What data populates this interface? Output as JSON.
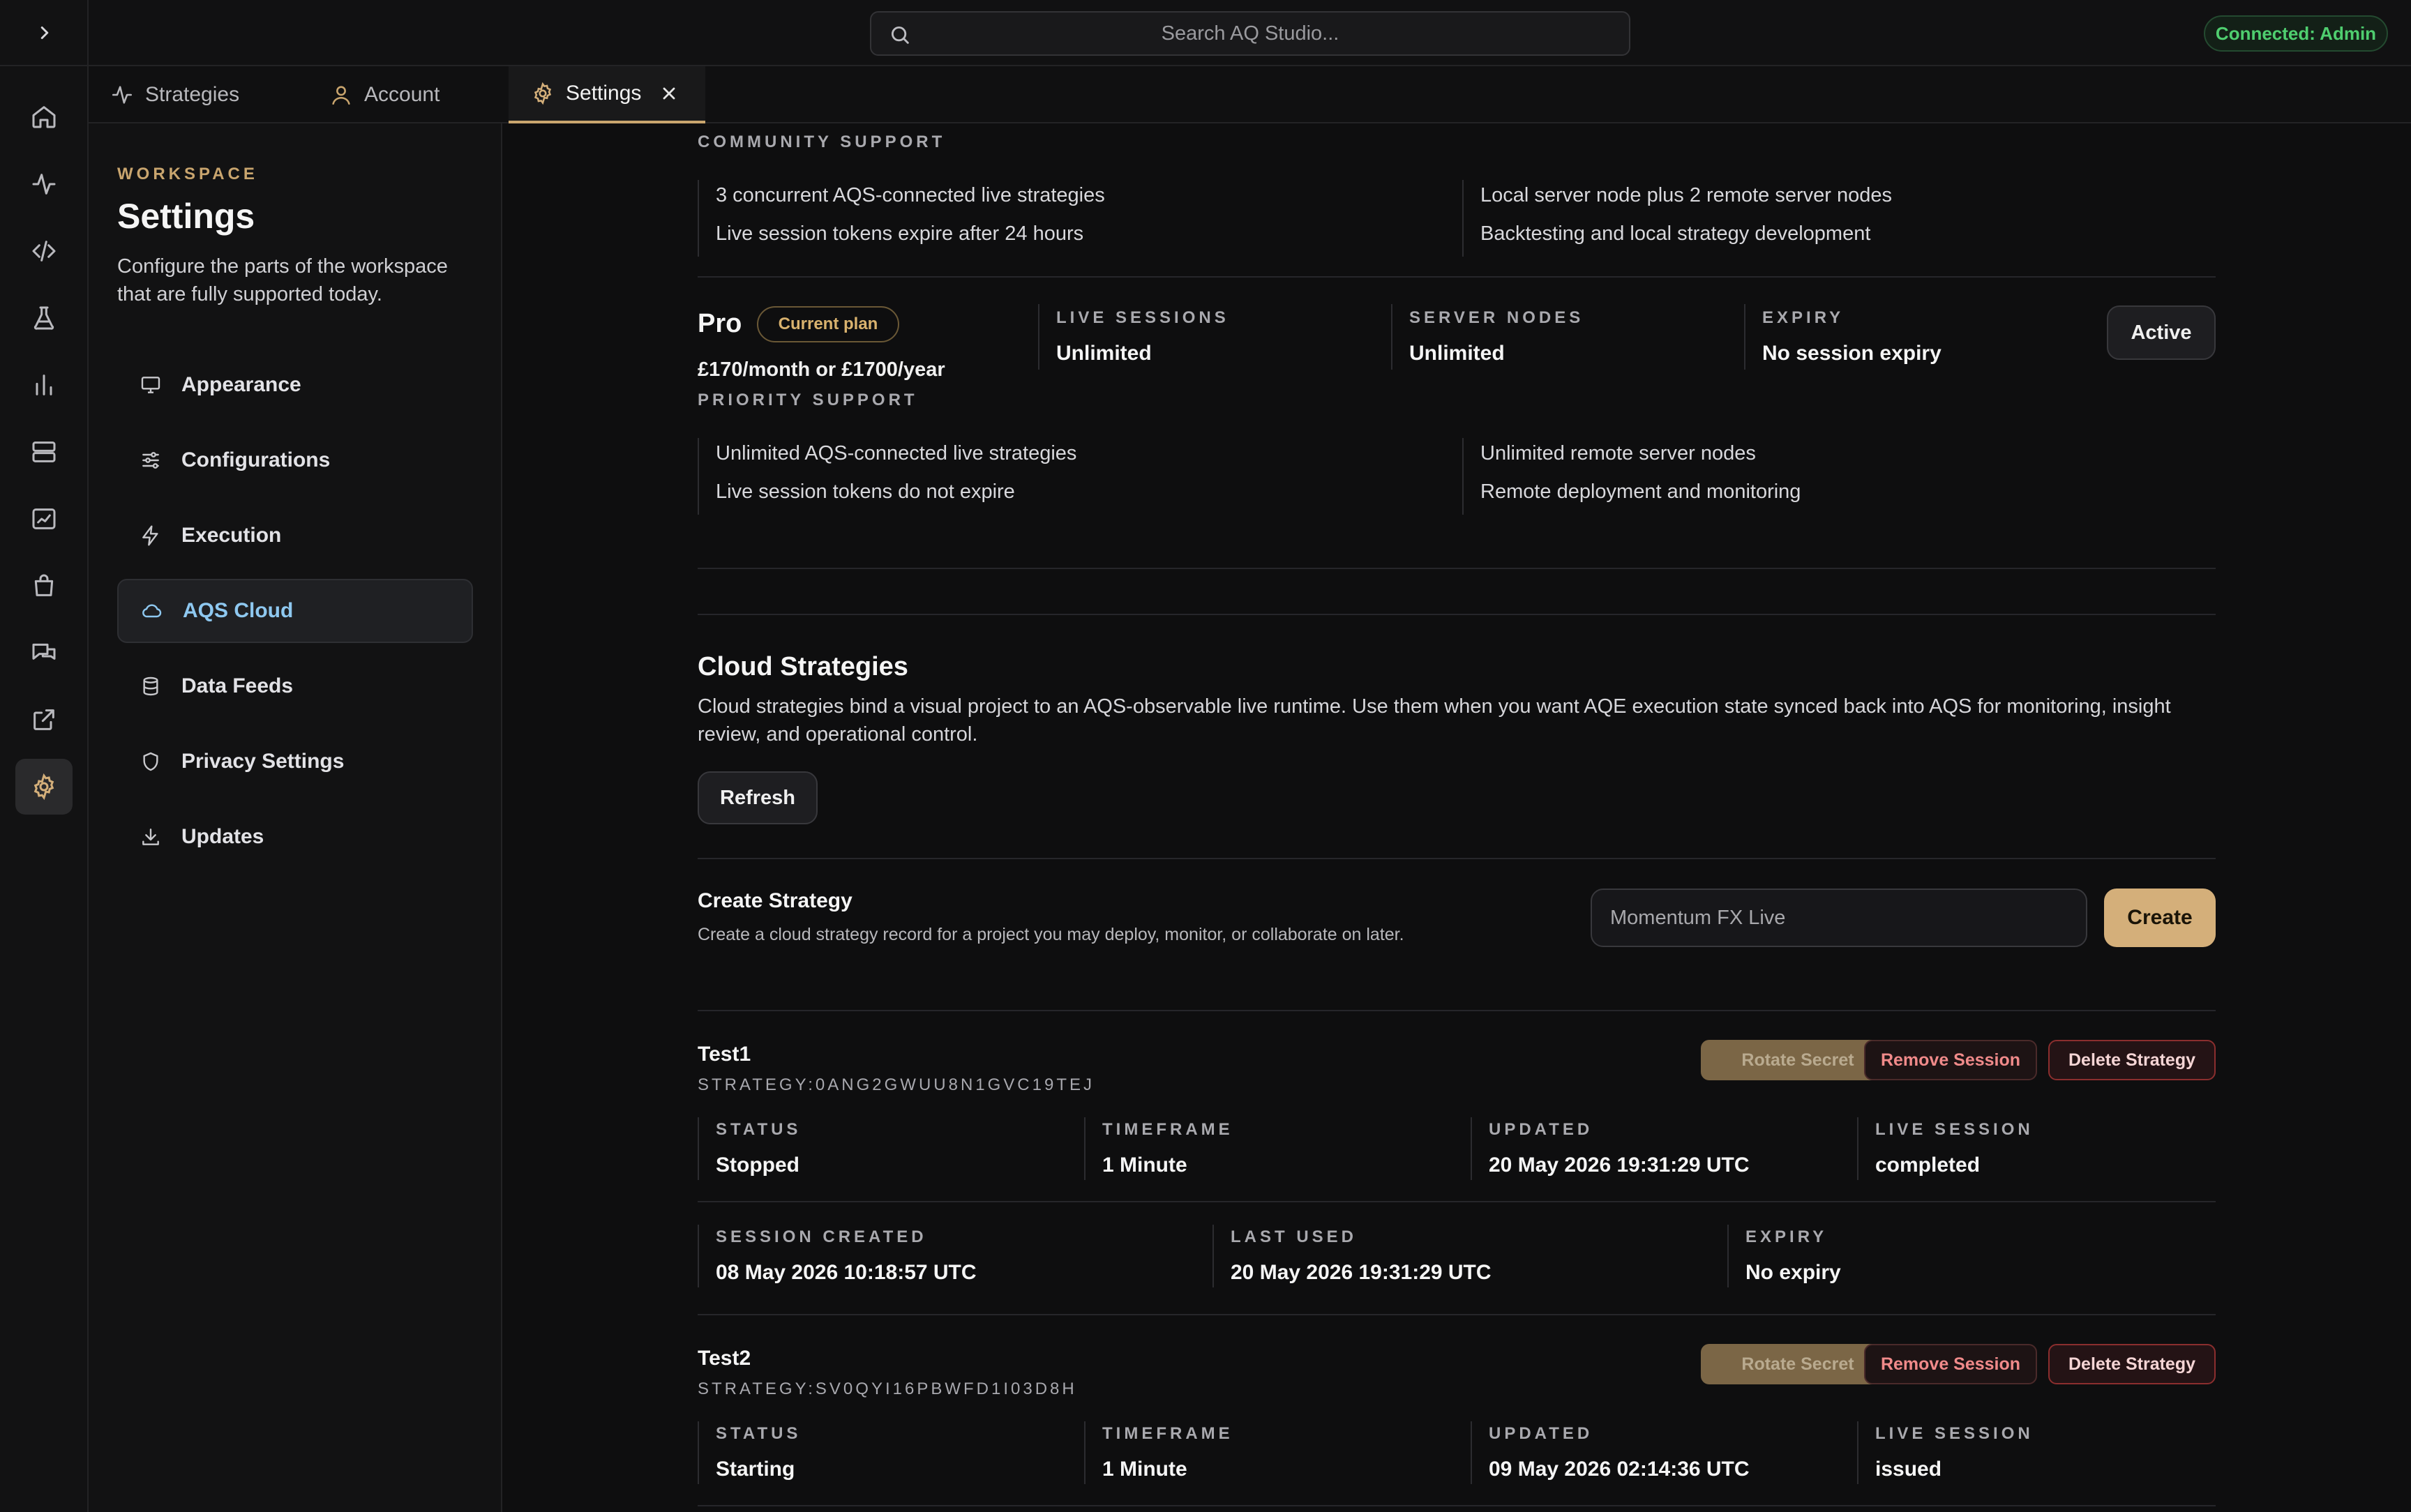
{
  "topbar": {
    "search_placeholder": "Search AQ Studio...",
    "connection": "Connected: Admin"
  },
  "tabs": [
    {
      "label": "Strategies"
    },
    {
      "label": "Account"
    },
    {
      "label": "Settings",
      "active": true
    }
  ],
  "rail": {
    "icons": [
      "home-icon",
      "activity-icon",
      "code-icon",
      "flask-icon",
      "bar-chart-icon",
      "server-icon",
      "line-chart-icon",
      "shopping-bag-icon",
      "messages-icon",
      "external-link-icon",
      "settings-icon"
    ],
    "active": "settings-icon"
  },
  "sidebar": {
    "eyebrow": "WORKSPACE",
    "title": "Settings",
    "description": "Configure the parts of the workspace that are fully supported today.",
    "items": [
      {
        "label": "Appearance",
        "icon": "monitor-icon"
      },
      {
        "label": "Configurations",
        "icon": "sliders-icon"
      },
      {
        "label": "Execution",
        "icon": "zap-icon"
      },
      {
        "label": "AQS Cloud",
        "icon": "cloud-icon",
        "active": true
      },
      {
        "label": "Data Feeds",
        "icon": "database-icon"
      },
      {
        "label": "Privacy Settings",
        "icon": "shield-icon"
      },
      {
        "label": "Updates",
        "icon": "download-icon"
      }
    ]
  },
  "community": {
    "label": "COMMUNITY SUPPORT",
    "features": [
      "3 concurrent AQS-connected live strategies",
      "Live session tokens expire after 24 hours",
      "Local server node plus 2 remote server nodes",
      "Backtesting and local strategy development"
    ]
  },
  "pro": {
    "name": "Pro",
    "badge": "Current plan",
    "price": "£170/month or £1700/year",
    "support": "PRIORITY SUPPORT",
    "stats": [
      {
        "label": "LIVE SESSIONS",
        "value": "Unlimited"
      },
      {
        "label": "SERVER NODES",
        "value": "Unlimited"
      },
      {
        "label": "EXPIRY",
        "value": "No session expiry"
      }
    ],
    "status_button": "Active",
    "features": [
      "Unlimited AQS-connected live strategies",
      "Live session tokens do not expire",
      "Unlimited remote server nodes",
      "Remote deployment and monitoring"
    ]
  },
  "cloud": {
    "title": "Cloud Strategies",
    "description": "Cloud strategies bind a visual project to an AQS-observable live runtime. Use them when you want AQE execution state synced back into AQS for monitoring, insight review, and operational control.",
    "refresh": "Refresh",
    "create": {
      "title": "Create Strategy",
      "description": "Create a cloud strategy record for a project you may deploy, monitor, or collaborate on later.",
      "input_value": "Momentum FX Live",
      "button": "Create"
    }
  },
  "strategy_actions": {
    "rotate": "Rotate Secret",
    "remove": "Remove Session",
    "delete": "Delete Strategy"
  },
  "strategies": [
    {
      "name": "Test1",
      "id": "STRATEGY:0ANG2GWUU8N1GVC19TEJ",
      "row1": [
        {
          "label": "STATUS",
          "value": "Stopped"
        },
        {
          "label": "TIMEFRAME",
          "value": "1 Minute"
        },
        {
          "label": "UPDATED",
          "value": "20 May 2026 19:31:29 UTC"
        },
        {
          "label": "LIVE SESSION",
          "value": "completed"
        }
      ],
      "row2": [
        {
          "label": "SESSION CREATED",
          "value": "08 May 2026 10:18:57 UTC"
        },
        {
          "label": "LAST USED",
          "value": "20 May 2026 19:31:29 UTC"
        },
        {
          "label": "EXPIRY",
          "value": "No expiry"
        }
      ]
    },
    {
      "name": "Test2",
      "id": "STRATEGY:SV0QYI16PBWFD1I03D8H",
      "row1": [
        {
          "label": "STATUS",
          "value": "Starting"
        },
        {
          "label": "TIMEFRAME",
          "value": "1 Minute"
        },
        {
          "label": "UPDATED",
          "value": "09 May 2026 02:14:36 UTC"
        },
        {
          "label": "LIVE SESSION",
          "value": "issued"
        }
      ]
    }
  ]
}
